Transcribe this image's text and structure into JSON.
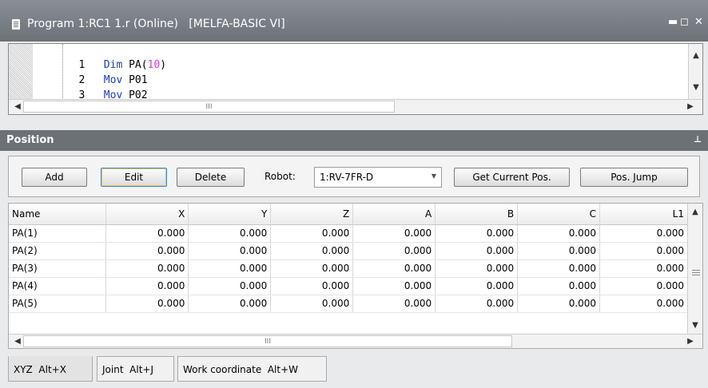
{
  "window": {
    "title": "Program 1:RC1 1.r (Online)   [MELFA-BASIC VI]",
    "minimize_glyph": "▬",
    "restore_glyph": "◻",
    "close_glyph": "✕"
  },
  "editor": {
    "lines": [
      {
        "num": "1",
        "kw": "Dim",
        "rest_before": " PA(",
        "num_literal": "10",
        "rest_after": ")"
      },
      {
        "num": "2",
        "kw": "Mov",
        "rest_before": " P01",
        "num_literal": "",
        "rest_after": ""
      },
      {
        "num": "3",
        "kw": "Mov",
        "rest_before": " P02",
        "num_literal": "",
        "rest_after": ""
      }
    ],
    "scroll_thumb_glyph": "III"
  },
  "position_panel": {
    "title": "Position",
    "pin_glyph": "⊥",
    "buttons": {
      "add": "Add",
      "edit": "Edit",
      "delete": "Delete",
      "get_current_pos": "Get Current Pos.",
      "pos_jump": "Pos. Jump"
    },
    "robot_label": "Robot:",
    "robot_value": "1:RV-7FR-D"
  },
  "grid": {
    "columns": [
      "Name",
      "X",
      "Y",
      "Z",
      "A",
      "B",
      "C",
      "L1"
    ],
    "rows": [
      {
        "name": "PA(1)",
        "values": [
          "0.000",
          "0.000",
          "0.000",
          "0.000",
          "0.000",
          "0.000",
          "0.000"
        ]
      },
      {
        "name": "PA(2)",
        "values": [
          "0.000",
          "0.000",
          "0.000",
          "0.000",
          "0.000",
          "0.000",
          "0.000"
        ]
      },
      {
        "name": "PA(3)",
        "values": [
          "0.000",
          "0.000",
          "0.000",
          "0.000",
          "0.000",
          "0.000",
          "0.000"
        ]
      },
      {
        "name": "PA(4)",
        "values": [
          "0.000",
          "0.000",
          "0.000",
          "0.000",
          "0.000",
          "0.000",
          "0.000"
        ]
      },
      {
        "name": "PA(5)",
        "values": [
          "0.000",
          "0.000",
          "0.000",
          "0.000",
          "0.000",
          "0.000",
          "0.000"
        ]
      }
    ],
    "scroll_thumb_glyph": "III"
  },
  "tabs": [
    {
      "label": "XYZ  Alt+X",
      "active": true
    },
    {
      "label": "Joint  Alt+J",
      "active": false
    },
    {
      "label": "Work coordinate  Alt+W",
      "active": false
    }
  ]
}
